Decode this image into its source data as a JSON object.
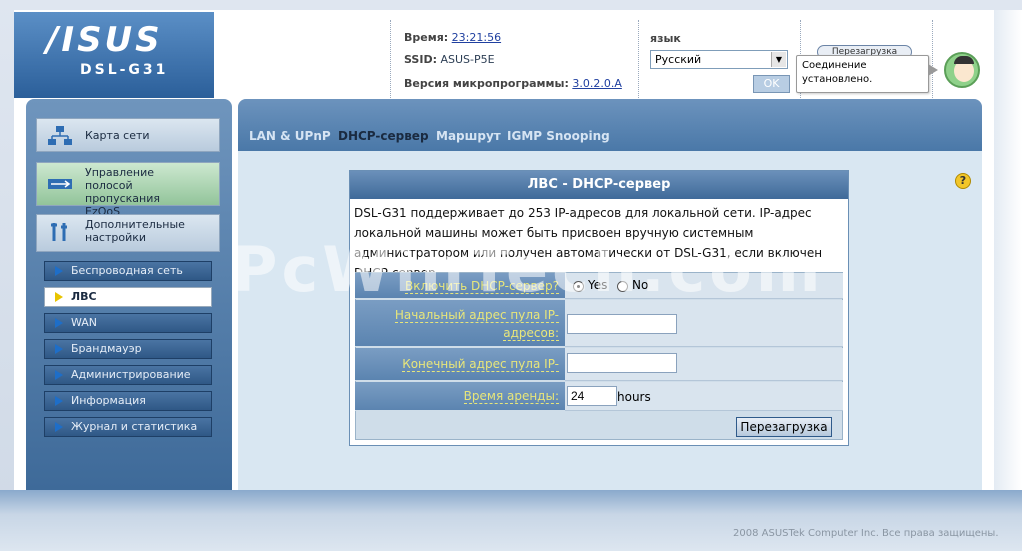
{
  "header": {
    "brand": "/ISUS",
    "model": "DSL-G31",
    "time_label": "Время:",
    "time_value": "23:21:56",
    "ssid_label": "SSID:",
    "ssid_value": "ASUS-P5E",
    "firmware_label": "Версия микропрограммы:",
    "firmware_value": "3.0.2.0.A",
    "language_label": "язык",
    "language_selected": "Русский",
    "ok_button": "OK",
    "logout_button": "Перезагрузка",
    "status_tooltip": "Соединение установлено."
  },
  "sidebar": {
    "main_items": [
      {
        "label": "Карта сети",
        "icon": "network-map-icon"
      },
      {
        "label": "Управление полосой пропускания EzQoS",
        "icon": "bandwidth-icon"
      },
      {
        "label": "Дополнительные настройки",
        "icon": "tools-icon"
      }
    ],
    "sub_items": [
      {
        "label": "Беспроводная сеть",
        "active": false
      },
      {
        "label": "ЛВС",
        "active": true
      },
      {
        "label": "WAN",
        "active": false
      },
      {
        "label": "Брандмауэр",
        "active": false
      },
      {
        "label": "Администрирование",
        "active": false
      },
      {
        "label": "Информация",
        "active": false
      },
      {
        "label": "Журнал и статистика",
        "active": false
      }
    ]
  },
  "tabs": [
    {
      "label": "LAN & UPnP",
      "active": false
    },
    {
      "label": "DHCP-сервер",
      "active": true
    },
    {
      "label": "Маршрут",
      "active": false
    },
    {
      "label": "IGMP Snooping",
      "active": false
    }
  ],
  "panel": {
    "title": "ЛВС - DHCP-сервер",
    "description": "DSL-G31 поддерживает до 253 IP-адресов для локальной сети. IP-адрес локальной машины может быть присвоен вручную системным администратором или получен автоматически от DSL-G31, если включен DHCP-сервер.",
    "fields": {
      "enable_dhcp_label": "Включить DHCP-сервер?",
      "yes_label": "Yes",
      "no_label": "No",
      "enable_dhcp_value": "Yes",
      "start_pool_label": "Начальный адрес пула IP-адресов:",
      "start_pool_value": "",
      "end_pool_label": "Конечный адрес пула IP-адресов:",
      "end_pool_value": "",
      "lease_label": "Время аренды:",
      "lease_value": "24",
      "lease_unit": "hours"
    },
    "reboot_button": "Перезагрузка"
  },
  "watermark": "PcWinTech.com",
  "footer": {
    "copyright": "2008 ASUSTek Computer Inc. Все права защищены."
  },
  "colors": {
    "accent_blue": "#4a78a8",
    "label_yellow": "#e8e67a",
    "active_green": "#92c49a"
  }
}
